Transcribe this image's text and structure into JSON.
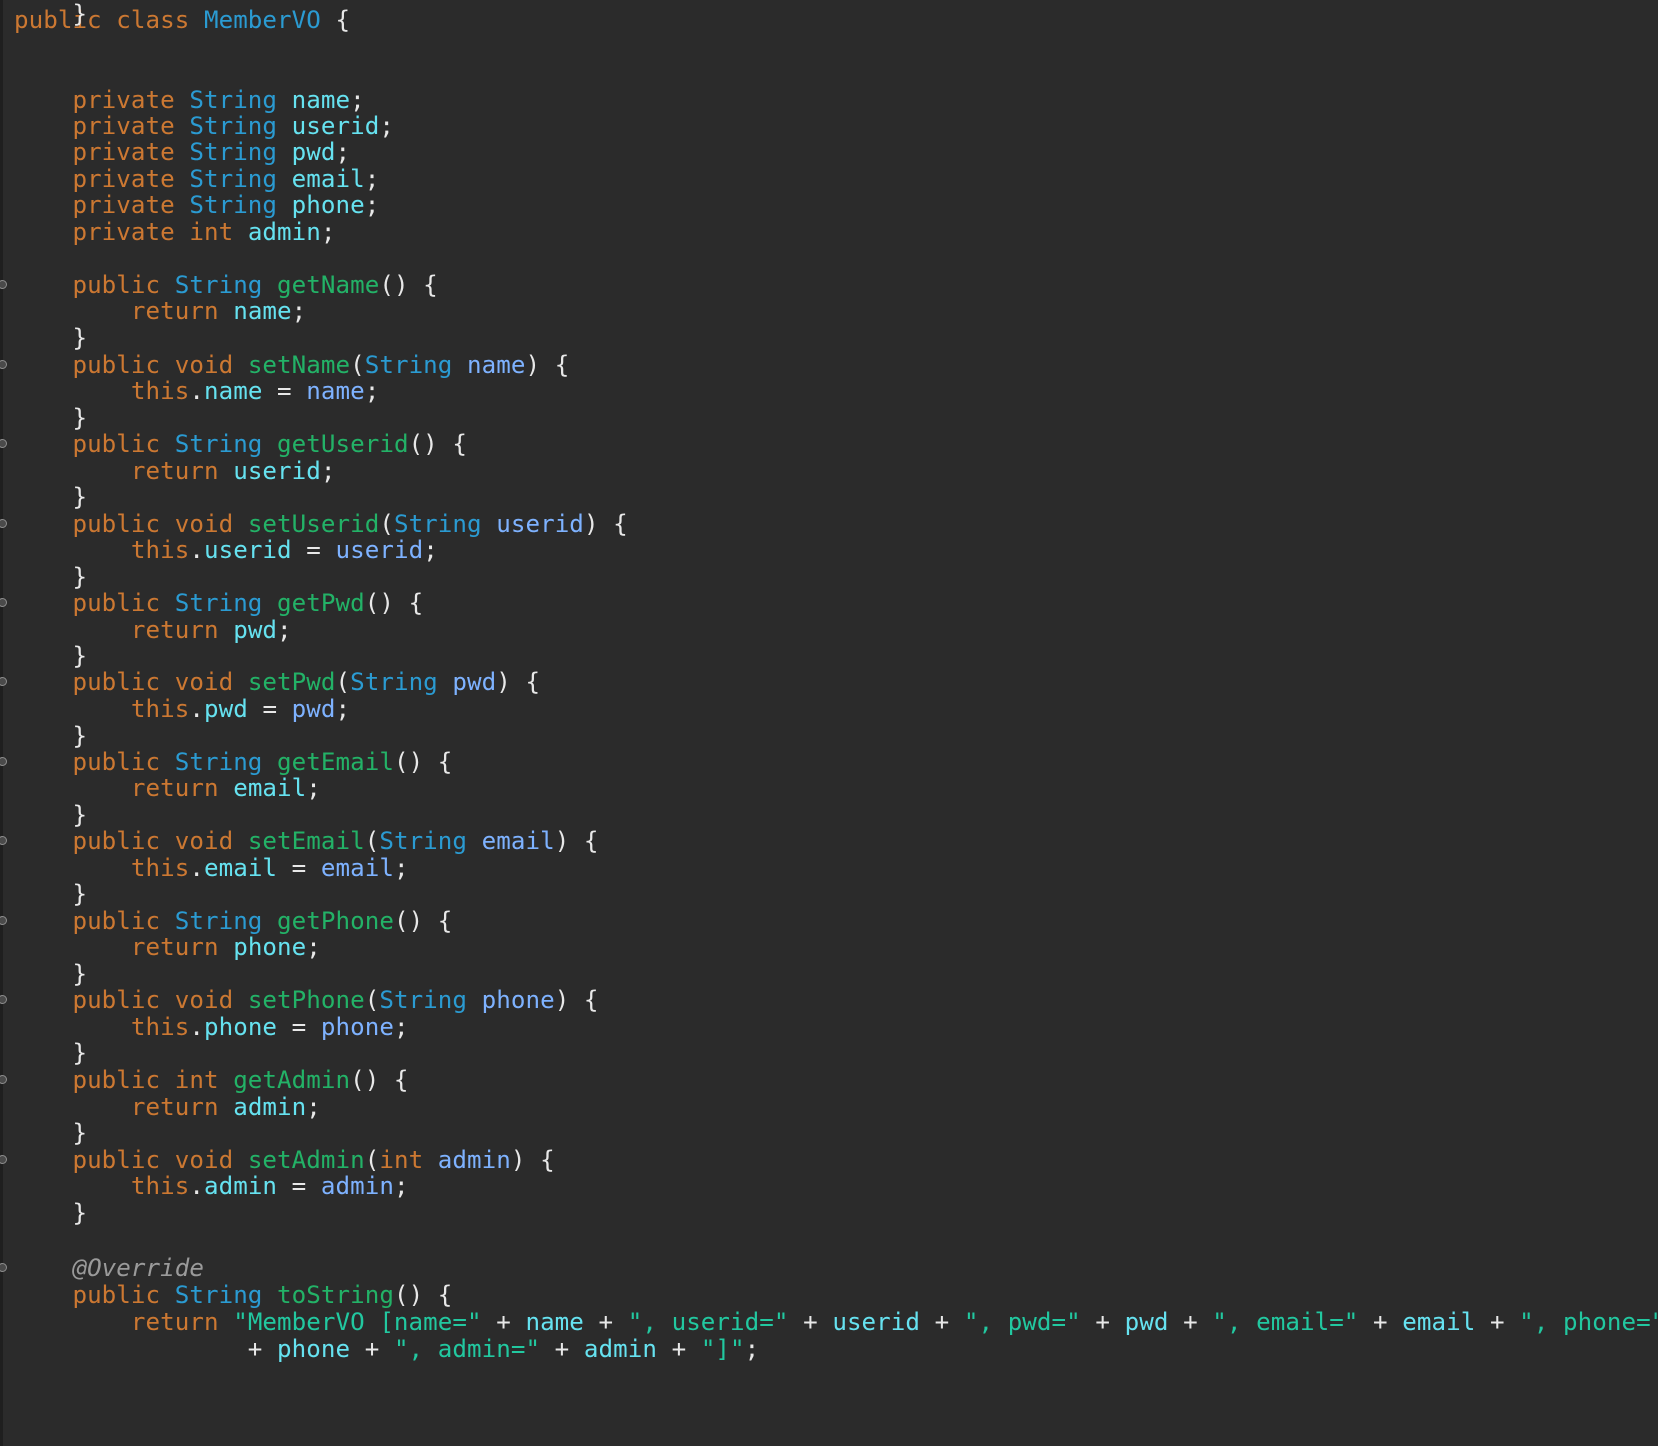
{
  "editor": {
    "colors": {
      "background": "#2b2b2b",
      "keyword": "#cc7832",
      "type": "#2b9bd2",
      "field": "#66e2f0",
      "method": "#23b267",
      "parameter": "#7eb2ff",
      "punctuation": "#e8e8e8",
      "string": "#22c8a0",
      "annotation": "#9a9a9a"
    },
    "gutter_marker_rows": [
      9,
      12,
      15,
      18,
      21,
      24,
      27,
      30,
      33,
      36,
      39,
      42,
      46
    ],
    "lines": [
      [
        [
          "kw",
          "public class "
        ],
        [
          "cls",
          "MemberVO"
        ],
        [
          "pn",
          " {"
        ]
      ],
      [],
      [
        [
          "pn",
          "    "
        ],
        [
          "kw",
          "private "
        ],
        [
          "ty",
          "String "
        ],
        [
          "fld",
          "name"
        ],
        [
          "pn",
          ";"
        ]
      ],
      [
        [
          "pn",
          "    "
        ],
        [
          "kw",
          "private "
        ],
        [
          "ty",
          "String "
        ],
        [
          "fld",
          "userid"
        ],
        [
          "pn",
          ";"
        ]
      ],
      [
        [
          "pn",
          "    "
        ],
        [
          "kw",
          "private "
        ],
        [
          "ty",
          "String "
        ],
        [
          "fld",
          "pwd"
        ],
        [
          "pn",
          ";"
        ]
      ],
      [
        [
          "pn",
          "    "
        ],
        [
          "kw",
          "private "
        ],
        [
          "ty",
          "String "
        ],
        [
          "fld",
          "email"
        ],
        [
          "pn",
          ";"
        ]
      ],
      [
        [
          "pn",
          "    "
        ],
        [
          "kw",
          "private "
        ],
        [
          "ty",
          "String "
        ],
        [
          "fld",
          "phone"
        ],
        [
          "pn",
          ";"
        ]
      ],
      [
        [
          "pn",
          "    "
        ],
        [
          "kw",
          "private int "
        ],
        [
          "fld",
          "admin"
        ],
        [
          "pn",
          ";"
        ]
      ],
      [],
      [
        [
          "pn",
          "    "
        ],
        [
          "kw",
          "public "
        ],
        [
          "ty",
          "String "
        ],
        [
          "fn",
          "getName"
        ],
        [
          "pn",
          "() {"
        ]
      ],
      [
        [
          "pn",
          "        "
        ],
        [
          "kw",
          "return "
        ],
        [
          "fld",
          "name"
        ],
        [
          "pn",
          ";"
        ]
      ],
      [
        [
          "pn",
          "    }"
        ]
      ],
      [
        [
          "pn",
          "    "
        ],
        [
          "kw",
          "public void "
        ],
        [
          "fn",
          "setName"
        ],
        [
          "pn",
          "("
        ],
        [
          "ty",
          "String "
        ],
        [
          "prm",
          "name"
        ],
        [
          "pn",
          ") {"
        ]
      ],
      [
        [
          "pn",
          "        "
        ],
        [
          "kw",
          "this"
        ],
        [
          "pn",
          "."
        ],
        [
          "fld",
          "name"
        ],
        [
          "pn",
          " = "
        ],
        [
          "prm",
          "name"
        ],
        [
          "pn",
          ";"
        ]
      ],
      [
        [
          "pn",
          "    }"
        ]
      ],
      [
        [
          "pn",
          "    "
        ],
        [
          "kw",
          "public "
        ],
        [
          "ty",
          "String "
        ],
        [
          "fn",
          "getUserid"
        ],
        [
          "pn",
          "() {"
        ]
      ],
      [
        [
          "pn",
          "        "
        ],
        [
          "kw",
          "return "
        ],
        [
          "fld",
          "userid"
        ],
        [
          "pn",
          ";"
        ]
      ],
      [
        [
          "pn",
          "    }"
        ]
      ],
      [
        [
          "pn",
          "    "
        ],
        [
          "kw",
          "public void "
        ],
        [
          "fn",
          "setUserid"
        ],
        [
          "pn",
          "("
        ],
        [
          "ty",
          "String "
        ],
        [
          "prm",
          "userid"
        ],
        [
          "pn",
          ") {"
        ]
      ],
      [
        [
          "pn",
          "        "
        ],
        [
          "kw",
          "this"
        ],
        [
          "pn",
          "."
        ],
        [
          "fld",
          "userid"
        ],
        [
          "pn",
          " = "
        ],
        [
          "prm",
          "userid"
        ],
        [
          "pn",
          ";"
        ]
      ],
      [
        [
          "pn",
          "    }"
        ]
      ],
      [
        [
          "pn",
          "    "
        ],
        [
          "kw",
          "public "
        ],
        [
          "ty",
          "String "
        ],
        [
          "fn",
          "getPwd"
        ],
        [
          "pn",
          "() {"
        ]
      ],
      [
        [
          "pn",
          "        "
        ],
        [
          "kw",
          "return "
        ],
        [
          "fld",
          "pwd"
        ],
        [
          "pn",
          ";"
        ]
      ],
      [
        [
          "pn",
          "    }"
        ]
      ],
      [
        [
          "pn",
          "    "
        ],
        [
          "kw",
          "public void "
        ],
        [
          "fn",
          "setPwd"
        ],
        [
          "pn",
          "("
        ],
        [
          "ty",
          "String "
        ],
        [
          "prm",
          "pwd"
        ],
        [
          "pn",
          ") {"
        ]
      ],
      [
        [
          "pn",
          "        "
        ],
        [
          "kw",
          "this"
        ],
        [
          "pn",
          "."
        ],
        [
          "fld",
          "pwd"
        ],
        [
          "pn",
          " = "
        ],
        [
          "prm",
          "pwd"
        ],
        [
          "pn",
          ";"
        ]
      ],
      [
        [
          "pn",
          "    }"
        ]
      ],
      [
        [
          "pn",
          "    "
        ],
        [
          "kw",
          "public "
        ],
        [
          "ty",
          "String "
        ],
        [
          "fn",
          "getEmail"
        ],
        [
          "pn",
          "() {"
        ]
      ],
      [
        [
          "pn",
          "        "
        ],
        [
          "kw",
          "return "
        ],
        [
          "fld",
          "email"
        ],
        [
          "pn",
          ";"
        ]
      ],
      [
        [
          "pn",
          "    }"
        ]
      ],
      [
        [
          "pn",
          "    "
        ],
        [
          "kw",
          "public void "
        ],
        [
          "fn",
          "setEmail"
        ],
        [
          "pn",
          "("
        ],
        [
          "ty",
          "String "
        ],
        [
          "prm",
          "email"
        ],
        [
          "pn",
          ") {"
        ]
      ],
      [
        [
          "pn",
          "        "
        ],
        [
          "kw",
          "this"
        ],
        [
          "pn",
          "."
        ],
        [
          "fld",
          "email"
        ],
        [
          "pn",
          " = "
        ],
        [
          "prm",
          "email"
        ],
        [
          "pn",
          ";"
        ]
      ],
      [
        [
          "pn",
          "    }"
        ]
      ],
      [
        [
          "pn",
          "    "
        ],
        [
          "kw",
          "public "
        ],
        [
          "ty",
          "String "
        ],
        [
          "fn",
          "getPhone"
        ],
        [
          "pn",
          "() {"
        ]
      ],
      [
        [
          "pn",
          "        "
        ],
        [
          "kw",
          "return "
        ],
        [
          "fld",
          "phone"
        ],
        [
          "pn",
          ";"
        ]
      ],
      [
        [
          "pn",
          "    }"
        ]
      ],
      [
        [
          "pn",
          "    "
        ],
        [
          "kw",
          "public void "
        ],
        [
          "fn",
          "setPhone"
        ],
        [
          "pn",
          "("
        ],
        [
          "ty",
          "String "
        ],
        [
          "prm",
          "phone"
        ],
        [
          "pn",
          ") {"
        ]
      ],
      [
        [
          "pn",
          "        "
        ],
        [
          "kw",
          "this"
        ],
        [
          "pn",
          "."
        ],
        [
          "fld",
          "phone"
        ],
        [
          "pn",
          " = "
        ],
        [
          "prm",
          "phone"
        ],
        [
          "pn",
          ";"
        ]
      ],
      [
        [
          "pn",
          "    }"
        ]
      ],
      [
        [
          "pn",
          "    "
        ],
        [
          "kw",
          "public int "
        ],
        [
          "fn",
          "getAdmin"
        ],
        [
          "pn",
          "() {"
        ]
      ],
      [
        [
          "pn",
          "        "
        ],
        [
          "kw",
          "return "
        ],
        [
          "fld",
          "admin"
        ],
        [
          "pn",
          ";"
        ]
      ],
      [
        [
          "pn",
          "    }"
        ]
      ],
      [
        [
          "pn",
          "    "
        ],
        [
          "kw",
          "public void "
        ],
        [
          "fn",
          "setAdmin"
        ],
        [
          "pn",
          "("
        ],
        [
          "kw",
          "int "
        ],
        [
          "prm",
          "admin"
        ],
        [
          "pn",
          ") {"
        ]
      ],
      [
        [
          "pn",
          "        "
        ],
        [
          "kw",
          "this"
        ],
        [
          "pn",
          "."
        ],
        [
          "fld",
          "admin"
        ],
        [
          "pn",
          " = "
        ],
        [
          "prm",
          "admin"
        ],
        [
          "pn",
          ";"
        ]
      ],
      [
        [
          "pn",
          "    }"
        ]
      ],
      [],
      [
        [
          "pn",
          "    "
        ],
        [
          "ann",
          "@Override"
        ]
      ],
      [
        [
          "pn",
          "    "
        ],
        [
          "kw",
          "public "
        ],
        [
          "ty",
          "String "
        ],
        [
          "fn",
          "toString"
        ],
        [
          "pn",
          "() {"
        ]
      ],
      [
        [
          "pn",
          "        "
        ],
        [
          "kw",
          "return "
        ],
        [
          "str",
          "\"MemberVO [name=\""
        ],
        [
          "pn",
          " + "
        ],
        [
          "fld",
          "name"
        ],
        [
          "pn",
          " + "
        ],
        [
          "str",
          "\", userid=\""
        ],
        [
          "pn",
          " + "
        ],
        [
          "fld",
          "userid"
        ],
        [
          "pn",
          " + "
        ],
        [
          "str",
          "\", pwd=\""
        ],
        [
          "pn",
          " + "
        ],
        [
          "fld",
          "pwd"
        ],
        [
          "pn",
          " + "
        ],
        [
          "str",
          "\", email=\""
        ],
        [
          "pn",
          " + "
        ],
        [
          "fld",
          "email"
        ],
        [
          "pn",
          " + "
        ],
        [
          "str",
          "\", phone=\""
        ]
      ],
      [
        [
          "pn",
          "                "
        ],
        [
          "pn",
          "+ "
        ],
        [
          "fld",
          "phone"
        ],
        [
          "pn",
          " + "
        ],
        [
          "str",
          "\", admin=\""
        ],
        [
          "pn",
          " + "
        ],
        [
          "fld",
          "admin"
        ],
        [
          "pn",
          " + "
        ],
        [
          "str",
          "\"]\""
        ],
        [
          "pn",
          ";"
        ]
      ],
      [
        [
          "pn",
          "    }"
        ]
      ]
    ]
  }
}
